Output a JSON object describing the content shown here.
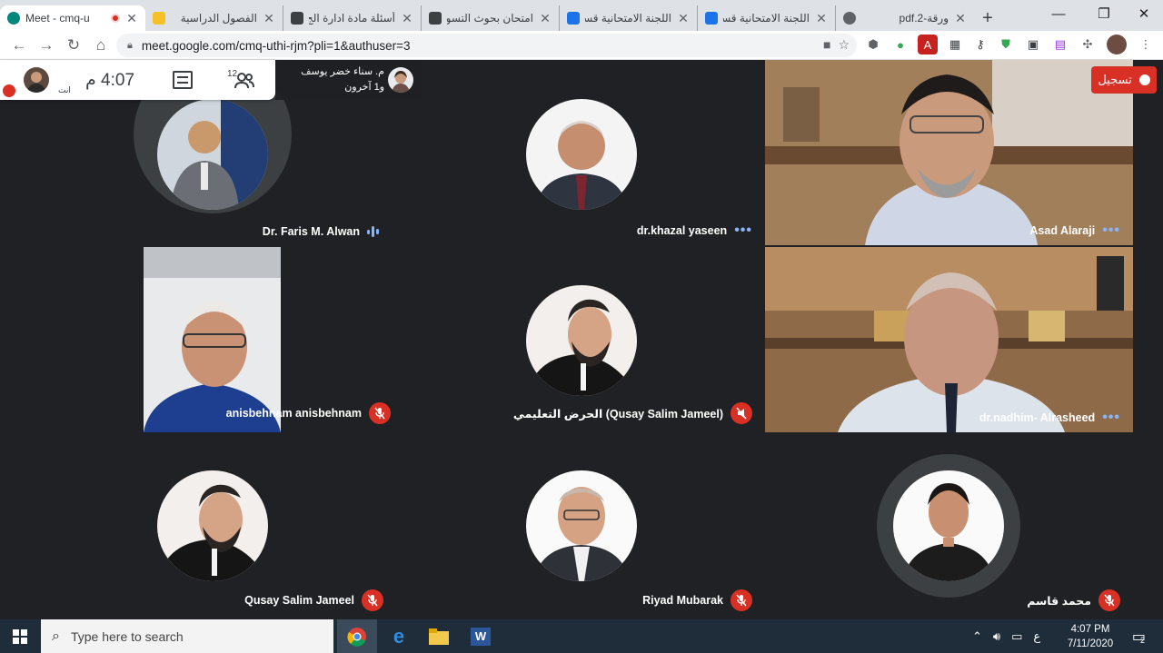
{
  "browser": {
    "tabs": [
      {
        "title": "Meet - cmq-u",
        "active": true,
        "recording": true
      },
      {
        "title": "الفصول الدراسية",
        "active": false
      },
      {
        "title": "أسئلة مادة ادارة الج",
        "active": false
      },
      {
        "title": "امتحان بحوث التسو",
        "active": false
      },
      {
        "title": "اللجنة الامتحانية قسم",
        "active": false
      },
      {
        "title": "اللجنة الامتحانية قسم",
        "active": false
      },
      {
        "title": "ورقة-pdf.2",
        "active": false
      }
    ],
    "new_tab": "+",
    "url": "meet.google.com/cmq-uthi-rjm?pli=1&authuser=3"
  },
  "meet": {
    "time": "4:07 م",
    "participants_count": "12",
    "self_label": "انت",
    "presenter_name": "م. سناء خضر يوسف",
    "presenter_others": "و1 آخرون",
    "record_label": "تسجيل"
  },
  "participants": [
    {
      "name": "Dr. Faris M. Alwan",
      "status": "speaking"
    },
    {
      "name": "dr.khazal yaseen",
      "status": "active"
    },
    {
      "name": "Asad Alaraji",
      "status": "active"
    },
    {
      "name": "anisbehnam anisbehnam",
      "status": "muted"
    },
    {
      "name": "(Qusay Salim Jameel) الحرض التعليمي",
      "status": "muted"
    },
    {
      "name": "dr.nadhim- Alrasheed",
      "status": "active"
    },
    {
      "name": "Qusay Salim Jameel",
      "status": "muted"
    },
    {
      "name": "Riyad Mubarak",
      "status": "muted"
    },
    {
      "name": "محمد قاسم",
      "status": "muted"
    }
  ],
  "taskbar": {
    "search_placeholder": "Type here to search",
    "ime": "ع",
    "clock_time": "4:07 PM",
    "clock_date": "7/11/2020",
    "notifications": "2"
  }
}
